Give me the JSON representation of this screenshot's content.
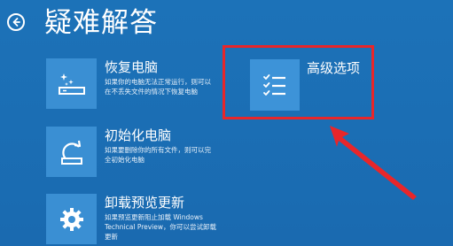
{
  "header": {
    "title": "疑难解答",
    "back_icon": "back-arrow-icon"
  },
  "options": [
    {
      "title": "恢复电脑",
      "desc_lines": [
        "如果你的电脑无法正常运行，则可以",
        "在不丢失文件的情况下恢复电脑"
      ],
      "icon": "refresh-pc-icon"
    },
    {
      "title": "初始化电脑",
      "desc_lines": [
        "如果要删除你的所有文件，则可以完",
        "全初始化电脑"
      ],
      "icon": "reset-pc-icon"
    },
    {
      "title": "卸载预览更新",
      "desc_lines": [
        "如果预览更新阻止加载 Windows",
        "Technical Preview，你可以尝试卸载",
        "更新"
      ],
      "icon": "gear-icon"
    }
  ],
  "advanced": {
    "title": "高级选项",
    "icon": "checklist-icon"
  },
  "annotation": {
    "highlight_color": "#e8262a",
    "arrow_color": "#e8262a"
  },
  "colors": {
    "background": "#1b6fb4",
    "tile": "#3a8fd3"
  }
}
